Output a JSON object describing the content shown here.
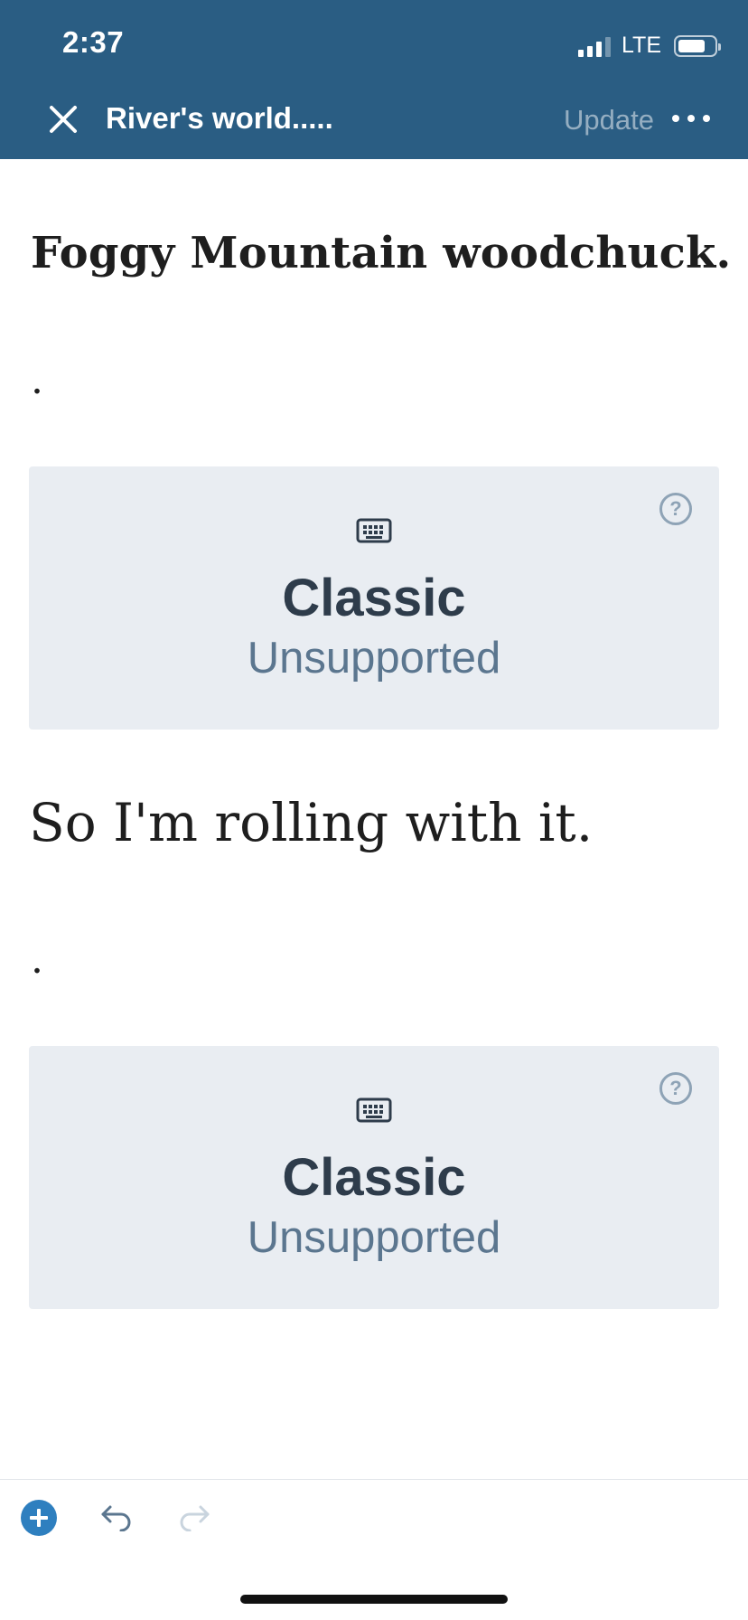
{
  "status_bar": {
    "time": "2:37",
    "network": "LTE",
    "icons": [
      "signal-icon",
      "battery-icon"
    ]
  },
  "header": {
    "title": "River's world.....",
    "update_label": "Update",
    "close_icon": "close-icon",
    "more_icon": "more-dots-icon",
    "background_color": "#2a5d83"
  },
  "content": {
    "heading": "Foggy Mountain woodchuck.",
    "paragraph_dot_1": ".",
    "block_1": {
      "icon": "keyboard-icon",
      "help_icon": "help-icon",
      "help_glyph": "?",
      "name": "Classic",
      "status": "Unsupported"
    },
    "paragraph_main": "So I'm rolling with it.",
    "paragraph_dot_2": ".",
    "block_2": {
      "icon": "keyboard-icon",
      "help_icon": "help-icon",
      "help_glyph": "?",
      "name": "Classic",
      "status": "Unsupported"
    }
  },
  "toolbar": {
    "add_icon": "plus-circle-icon",
    "undo_icon": "undo-icon",
    "redo_icon": "redo-icon",
    "accent_color": "#2e7fbf"
  }
}
